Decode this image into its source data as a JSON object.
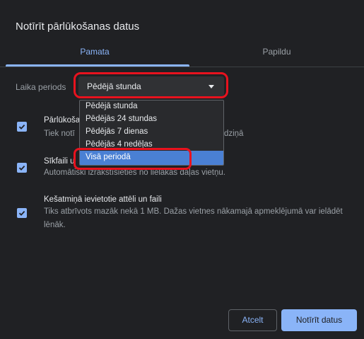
{
  "dialog": {
    "title": "Notīrīt pārlūkošanas datus"
  },
  "tabs": [
    {
      "label": "Pamata",
      "active": true
    },
    {
      "label": "Papildu",
      "active": false
    }
  ],
  "time_range": {
    "label": "Laika periods",
    "selected": "Pēdējā stunda",
    "options": [
      "Pēdējā stunda",
      "Pēdējās 24 stundas",
      "Pēdējās 7 dienas",
      "Pēdējās 4 nedēļas",
      "Visā periodā"
    ],
    "highlighted_option": "Visā periodā"
  },
  "items": [
    {
      "title": "Pārlūkoša",
      "description_start": "Tiek notī",
      "description_end": "lodziņā",
      "checked": true
    },
    {
      "title": "Sīkfaili u",
      "description": "Automātiski izrakstīsieties no lielākās daļas vietņu.",
      "checked": true
    },
    {
      "title": "Kešatmiņā ievietotie attēli un faili",
      "description": "Tiks atbrīvots mazāk nekā 1 MB. Dažas vietnes nākamajā apmeklējumā var ielādēt lēnāk.",
      "checked": true
    }
  ],
  "buttons": {
    "cancel": "Atcelt",
    "clear": "Notīrīt datus"
  },
  "colors": {
    "background": "#202124",
    "accent": "#8ab4f8",
    "highlight_red": "#e8121e",
    "option_selected": "#4a80d4"
  }
}
